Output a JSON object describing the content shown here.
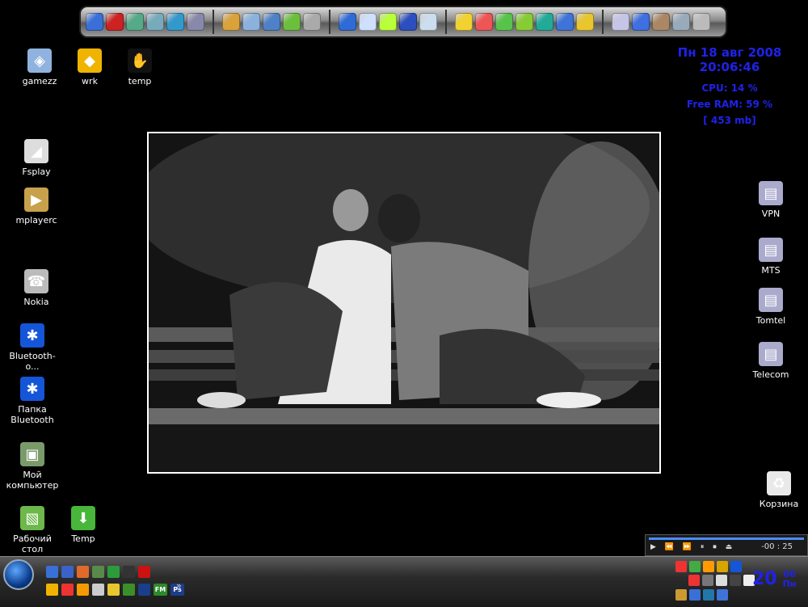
{
  "dock": {
    "groups": [
      [
        "#3a6fd8",
        "#c22",
        "#5a8",
        "#7ab",
        "#39c",
        "#88a"
      ],
      [
        "#d9a23a",
        "#8bb2dd",
        "#4f81c7",
        "#6cbf3c",
        "#aaa"
      ],
      [
        "#2f6bd6",
        "#cfe0ff",
        "#b9ff3a",
        "#2c4fbf",
        "#cde"
      ],
      [
        "#f2d230",
        "#e55",
        "#58c34a",
        "#8c3",
        "#2a9",
        "#3e73d8",
        "#e8c62e"
      ],
      [
        "#c5c5e8",
        "#3f6fe0",
        "#a86",
        "#9ab",
        "#bbb"
      ]
    ]
  },
  "desktop_left": [
    {
      "name": "desktop-icon-gamezz",
      "label": "gamezz",
      "color": "#8fb3de",
      "glyph": "◈"
    },
    {
      "name": "desktop-icon-wrk",
      "label": "wrk",
      "color": "#f0b400",
      "glyph": "◆"
    },
    {
      "name": "desktop-icon-temp",
      "label": "temp",
      "color": "#111",
      "glyph": "✋"
    },
    {
      "name": "desktop-icon-fsplay",
      "label": "Fsplay",
      "color": "#ddd",
      "glyph": "◢"
    },
    {
      "name": "desktop-icon-mplayerc",
      "label": "mplayerc",
      "color": "#c8a14d",
      "glyph": "▶"
    },
    {
      "name": "desktop-icon-nokia",
      "label": "Nokia",
      "color": "#bbb",
      "glyph": "☎"
    },
    {
      "name": "desktop-icon-bluetooth",
      "label": "Bluetooth-o...",
      "color": "#1555d8",
      "glyph": "✱"
    },
    {
      "name": "desktop-icon-bluetooth-folder",
      "label": "Папка Bluetooth",
      "color": "#1555d8",
      "glyph": "✱"
    },
    {
      "name": "desktop-icon-my-computer",
      "label": "Мой компьютер",
      "color": "#7a9a6a",
      "glyph": "▣"
    },
    {
      "name": "desktop-icon-desktop",
      "label": "Рабочий стол",
      "color": "#6db84a",
      "glyph": "▧"
    },
    {
      "name": "desktop-icon-temp-shortcut",
      "label": "Temp",
      "color": "#48b63a",
      "glyph": "⬇"
    }
  ],
  "desktop_right": [
    {
      "name": "desktop-icon-vpn",
      "label": "VPN",
      "color": "#aac",
      "glyph": "▤"
    },
    {
      "name": "desktop-icon-mts",
      "label": "MTS",
      "color": "#aac",
      "glyph": "▤"
    },
    {
      "name": "desktop-icon-tomtel",
      "label": "Tomtel",
      "color": "#aac",
      "glyph": "▤"
    },
    {
      "name": "desktop-icon-telecom",
      "label": "Telecom",
      "color": "#aac",
      "glyph": "▤"
    },
    {
      "name": "desktop-icon-recycle-bin",
      "label": "Корзина",
      "color": "#e9e9e9",
      "glyph": "♻"
    }
  ],
  "stats": {
    "date": "Пн 18 авг 2008",
    "time": "20:06:46",
    "cpu": "CPU: 14 %",
    "ram": "Free RAM: 59 %",
    "ram_mb": "[ 453 mb]"
  },
  "player": {
    "controls": "▶ ⏪ ⏩ ⏸ ⏹ ⏏",
    "time": "-00 : 25"
  },
  "taskbar": {
    "quicklaunch_top": [
      "#3a6fd8",
      "#3b62c8",
      "#e06a2b",
      "#5a8a4a",
      "#2c9c3a",
      "#333",
      "#c11"
    ],
    "quicklaunch_bottom": [
      "#f0b400",
      "#e33",
      "#f59a00",
      "#ccc",
      "#e8c62e",
      "#3b8f2a",
      "#1a3e8a"
    ],
    "ql_fm": "FM",
    "ql_ps": "Ps",
    "more": "»",
    "tray_top": [
      "#e33",
      "#4a4",
      "#ff9a00",
      "#d8a400",
      "#1555d8"
    ],
    "tray_mid": [
      "#e33",
      "#777",
      "#ddd",
      "#444",
      "#eee"
    ],
    "tray_bot": [
      "#c93",
      "#3a6fd8",
      "#27a",
      "#3e73d8"
    ],
    "clock_day": "20",
    "clock_month": "06",
    "clock_weekday": "Пн"
  }
}
